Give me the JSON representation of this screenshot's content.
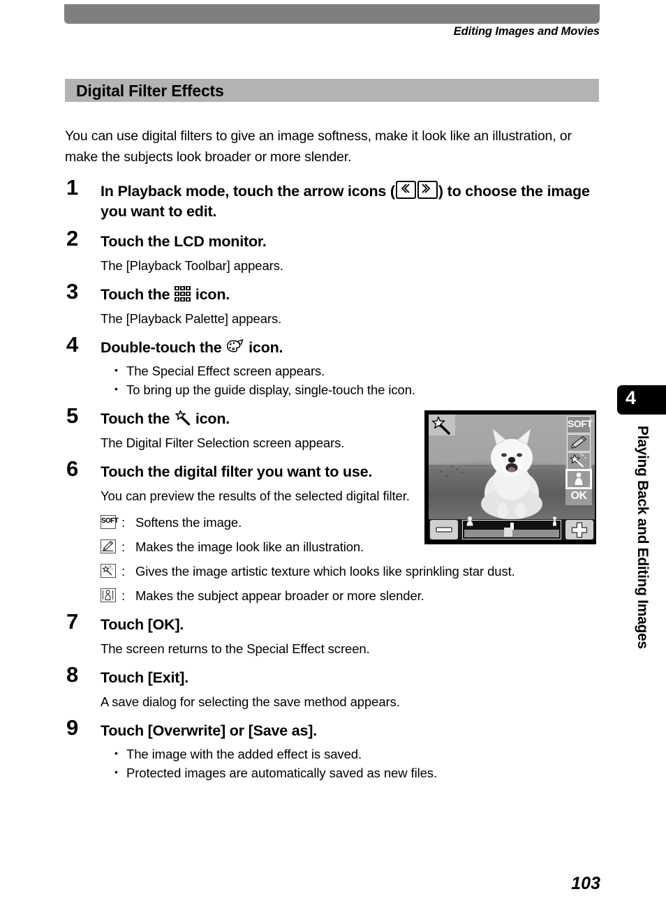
{
  "header": {
    "running_head": "Editing Images and Movies"
  },
  "section": {
    "title": "Digital Filter Effects"
  },
  "intro": "You can use digital filters to give an image softness, make it look like an illustration, or make the subjects look broader or more slender.",
  "steps": [
    {
      "number": "1",
      "head_before": "In Playback mode, touch the arrow icons (",
      "head_after": ") to choose the image you want to edit.",
      "icons": [
        "arrow-left-icon",
        "arrow-right-icon"
      ]
    },
    {
      "number": "2",
      "head": "Touch the LCD monitor.",
      "body": "The [Playback Toolbar] appears."
    },
    {
      "number": "3",
      "head_before": "Touch the ",
      "head_after": " icon.",
      "icons": [
        "playback-palette-grid-icon"
      ],
      "body": "The [Playback Palette] appears."
    },
    {
      "number": "4",
      "head_before": "Double-touch the ",
      "head_after": " icon.",
      "icons": [
        "artist-palette-icon"
      ],
      "bullets": [
        "The Special Effect screen appears.",
        "To bring up the guide display, single-touch the icon."
      ]
    },
    {
      "number": "5",
      "head_before": "Touch the ",
      "head_after": " icon.",
      "icons": [
        "magic-wand-star-icon"
      ],
      "body": "The Digital Filter Selection screen appears."
    },
    {
      "number": "6",
      "head": "Touch the digital filter you want to use.",
      "body": "You can preview the results of the selected digital filter."
    },
    {
      "number": "7",
      "head": "Touch [OK].",
      "body": "The screen returns to the Special Effect screen."
    },
    {
      "number": "8",
      "head": "Touch [Exit].",
      "body": "A save dialog for selecting the save method appears."
    },
    {
      "number": "9",
      "head": "Touch [Overwrite] or [Save as].",
      "bullets": [
        "The image with the added effect is saved.",
        "Protected images are automatically saved as new files."
      ]
    }
  ],
  "filter_legend": {
    "separator": ":",
    "rows": [
      {
        "icon": "soft-filter-icon",
        "icon_label": "SOFT",
        "text": "Softens the image."
      },
      {
        "icon": "illustration-filter-icon",
        "icon_label": "",
        "text": "Makes the image look like an illustration."
      },
      {
        "icon": "stardust-filter-icon",
        "icon_label": "",
        "text": "Gives the image artistic texture which looks like sprinkling star dust."
      },
      {
        "icon": "slim-filter-icon",
        "icon_label": "",
        "text": "Makes the subject appear broader or more slender."
      }
    ]
  },
  "lcd_screen": {
    "badge_icon": "magic-wand-star-icon",
    "buttons": [
      {
        "name": "soft-filter-button",
        "label": "SOFT",
        "selected": false
      },
      {
        "name": "illustration-filter-button",
        "label": "",
        "selected": false
      },
      {
        "name": "stardust-filter-button",
        "label": "",
        "selected": false
      },
      {
        "name": "slim-filter-button",
        "label": "",
        "selected": true
      }
    ],
    "ok_label": "OK",
    "minus_label": "minus-button",
    "plus_label": "plus-button",
    "slider_value_percent": 42
  },
  "chapter": {
    "number": "4",
    "label": "Playing Back and Editing Images"
  },
  "page_number": "103",
  "colors": {
    "top_bar": "#7f7f7f",
    "section_band": "#b3b3b3",
    "chapter_tab": "#000000",
    "page_background": "#ffffff"
  }
}
